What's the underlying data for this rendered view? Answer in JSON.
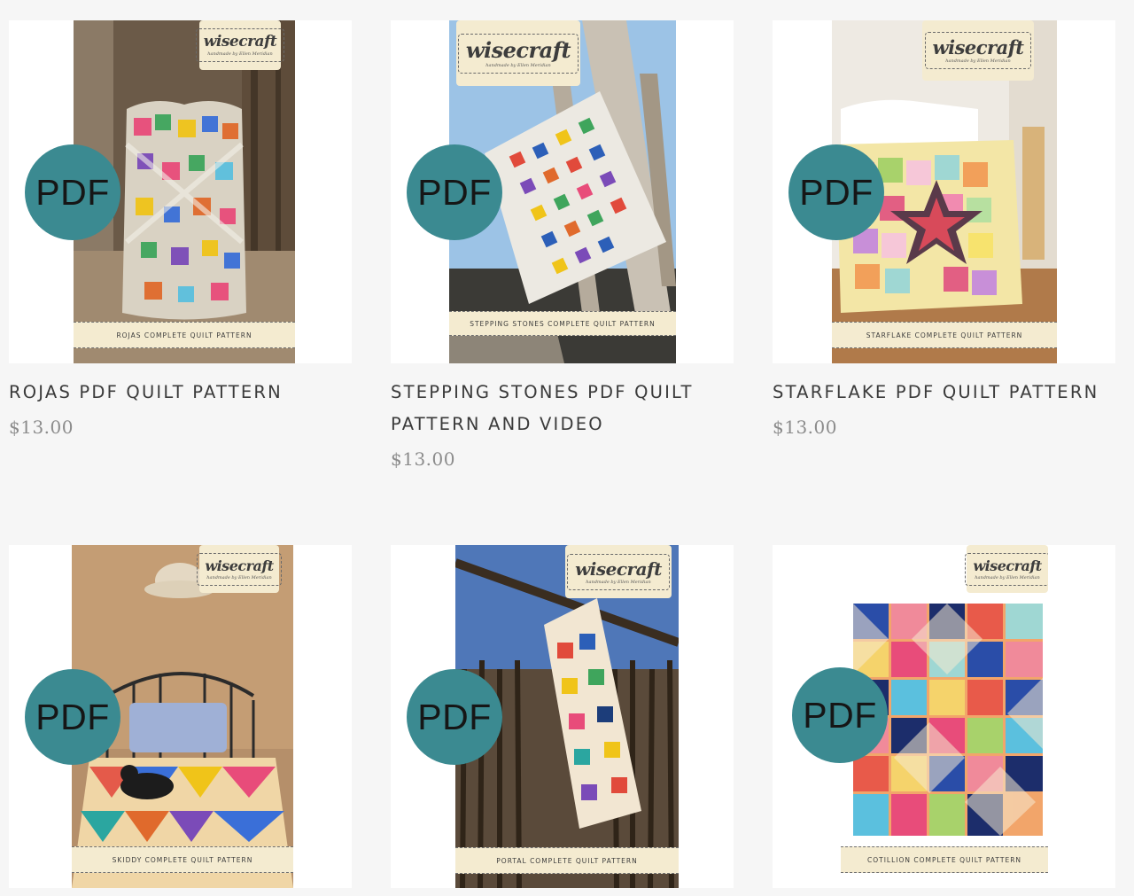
{
  "products": [
    {
      "title": "ROJAS PDF QUILT PATTERN",
      "price": "$13.00",
      "cover_label": "ROJAS COMPLETE QUILT PATTERN",
      "badge": "PDF",
      "brand": "wisecraft",
      "brand_tagline": "handmade by Ellen Meridian"
    },
    {
      "title": "STEPPING STONES PDF QUILT PATTERN AND VIDEO",
      "price": "$13.00",
      "cover_label": "STEPPING STONES COMPLETE QUILT PATTERN",
      "badge": "PDF",
      "brand": "wisecraft",
      "brand_tagline": "handmade by Ellen Meridian"
    },
    {
      "title": "STARFLAKE PDF QUILT PATTERN",
      "price": "$13.00",
      "cover_label": "STARFLAKE COMPLETE QUILT PATTERN",
      "badge": "PDF",
      "brand": "wisecraft",
      "brand_tagline": "handmade by Ellen Meridian"
    },
    {
      "title": "",
      "price": "",
      "cover_label": "SKIDDY COMPLETE QUILT PATTERN",
      "badge": "PDF",
      "brand": "wisecraft",
      "brand_tagline": "handmade by Ellen Meridian"
    },
    {
      "title": "",
      "price": "",
      "cover_label": "PORTAL COMPLETE QUILT PATTERN",
      "badge": "PDF",
      "brand": "wisecraft",
      "brand_tagline": "handmade by Ellen Meridian"
    },
    {
      "title": "",
      "price": "",
      "cover_label": "COTILLION COMPLETE QUILT PATTERN",
      "badge": "PDF",
      "brand": "wisecraft",
      "brand_tagline": "handmade by Ellen Meridian"
    }
  ],
  "colors": {
    "page_background": "#f6f6f6",
    "badge": "#3b8a91",
    "cover_label_band": "#f4ebd0",
    "title_text": "#3b3b3b",
    "price_text": "#8c8c8c"
  }
}
